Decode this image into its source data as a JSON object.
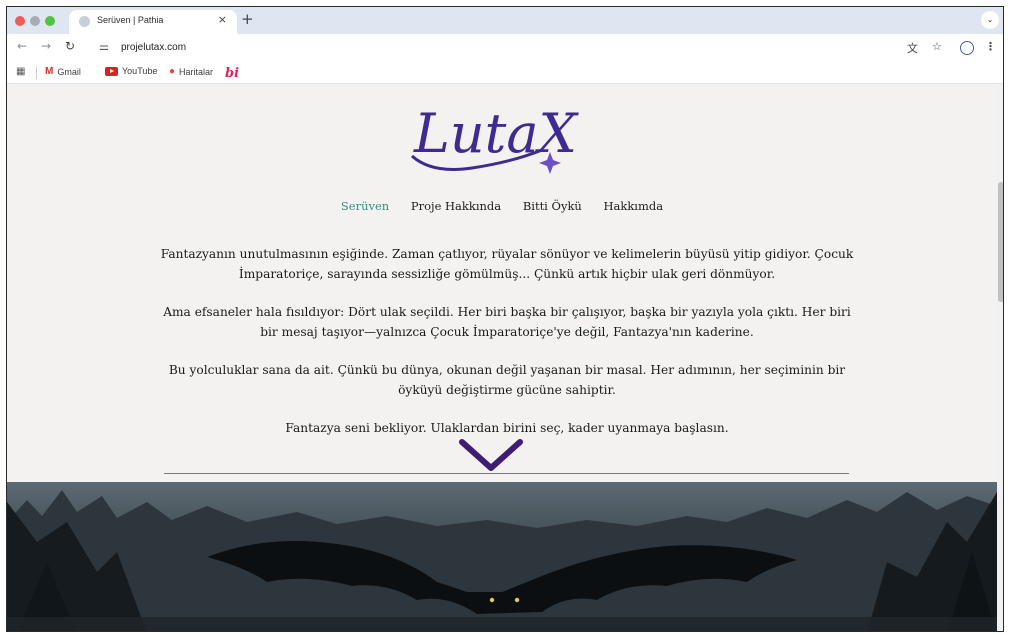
{
  "browser": {
    "tab_title": "Serüven | Pathia",
    "tab_close": "×",
    "new_tab": "+",
    "url": "projelutax.com",
    "icons": {
      "back": "back-arrow-icon",
      "forward": "forward-arrow-icon",
      "reload": "reload-icon",
      "site_info": "site-info-icon",
      "translate": "translate-icon",
      "bookmark": "star-icon",
      "profile": "profile-icon",
      "menu": "menu-icon"
    }
  },
  "bookmarks": [
    {
      "label": "Gmail",
      "icon": "gmail-icon"
    },
    {
      "label": "YouTube",
      "icon": "youtube-icon"
    },
    {
      "label": "Haritalar",
      "icon": "maps-icon"
    },
    {
      "label": "bi",
      "icon": "bi-icon"
    }
  ],
  "site": {
    "logo_text": "LutaX",
    "brand_color": "#3f2a91",
    "accent_color": "#3e8a7e",
    "nav": [
      {
        "label": "Serüven",
        "active": true
      },
      {
        "label": "Proje Hakkında",
        "active": false
      },
      {
        "label": "Bitti Öykü",
        "active": false
      },
      {
        "label": "Hakkımda",
        "active": false
      }
    ],
    "paragraphs": [
      "Fantazyanın unutulmasının eşiğinde. Zaman çatlıyor, rüyalar sönüyor ve kelimelerin büyüsü yitip gidiyor. Çocuk İmparatoriçe, sarayında sessizliğe gömülmüş... Çünkü artık hiçbir ulak geri dönmüyor.",
      "Ama efsaneler hala fısıldıyor: Dört ulak seçildi. Her biri başka bir çalışıyor, başka bir yazıyla yola çıktı. Her biri bir mesaj taşıyor—yalnızca Çocuk İmparatoriçe'ye değil, Fantazya'nın kaderine.",
      "Bu yolculuklar sana da ait. Çünkü bu dünya, okunan değil yaşanan bir masal. Her adımının, her seçiminin bir öyküyü değiştirme gücüne sahiptir.",
      "Fantazya seni bekliyor. Ulaklardan birini seç, kader uyanmaya başlasın."
    ],
    "scroll_icon": "chevron-down-icon",
    "hero_image": "dark-forest-bat-creature-image"
  }
}
